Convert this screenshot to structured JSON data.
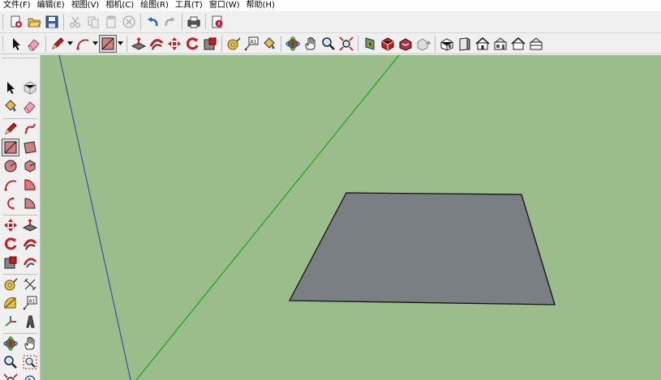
{
  "menu": [
    {
      "label": "文件(F)"
    },
    {
      "label": "编辑(E)"
    },
    {
      "label": "视图(V)"
    },
    {
      "label": "相机(C)"
    },
    {
      "label": "绘图(R)"
    },
    {
      "label": "工具(T)"
    },
    {
      "label": "窗口(W)"
    },
    {
      "label": "帮助(H)"
    }
  ],
  "toolbar_standard": [
    "new-icon",
    "open-icon",
    "save-icon",
    "cut-icon",
    "copy-icon",
    "paste-icon",
    "delete-icon",
    "undo-icon",
    "redo-icon",
    "print-icon",
    "model-info-icon"
  ],
  "toolbar_tools": [
    "select-icon",
    "eraser-icon",
    "pencil-icon",
    "arc-icon",
    "rectangle-icon",
    "push-pull-icon",
    "follow-me-icon",
    "move-icon",
    "rotate-icon",
    "scale-icon",
    "tape-measure-icon",
    "text-label-icon",
    "paint-bucket-icon",
    "orbit-icon",
    "pan-icon",
    "zoom-icon",
    "zoom-extents-icon",
    "section-plane-icon",
    "components-icon",
    "warehouse-icon",
    "share-model-icon",
    "iso-view-icon",
    "top-view-icon",
    "front-view-icon",
    "right-view-icon",
    "back-view-icon",
    "left-view-icon"
  ],
  "text_tool_label": "A1",
  "colors": {
    "viewport_bg": "#9abd8b",
    "face_fill": "#7a7f84",
    "red_axis": "#c00000",
    "green_axis": "#00a000",
    "blue_axis": "#2a3aa0"
  }
}
